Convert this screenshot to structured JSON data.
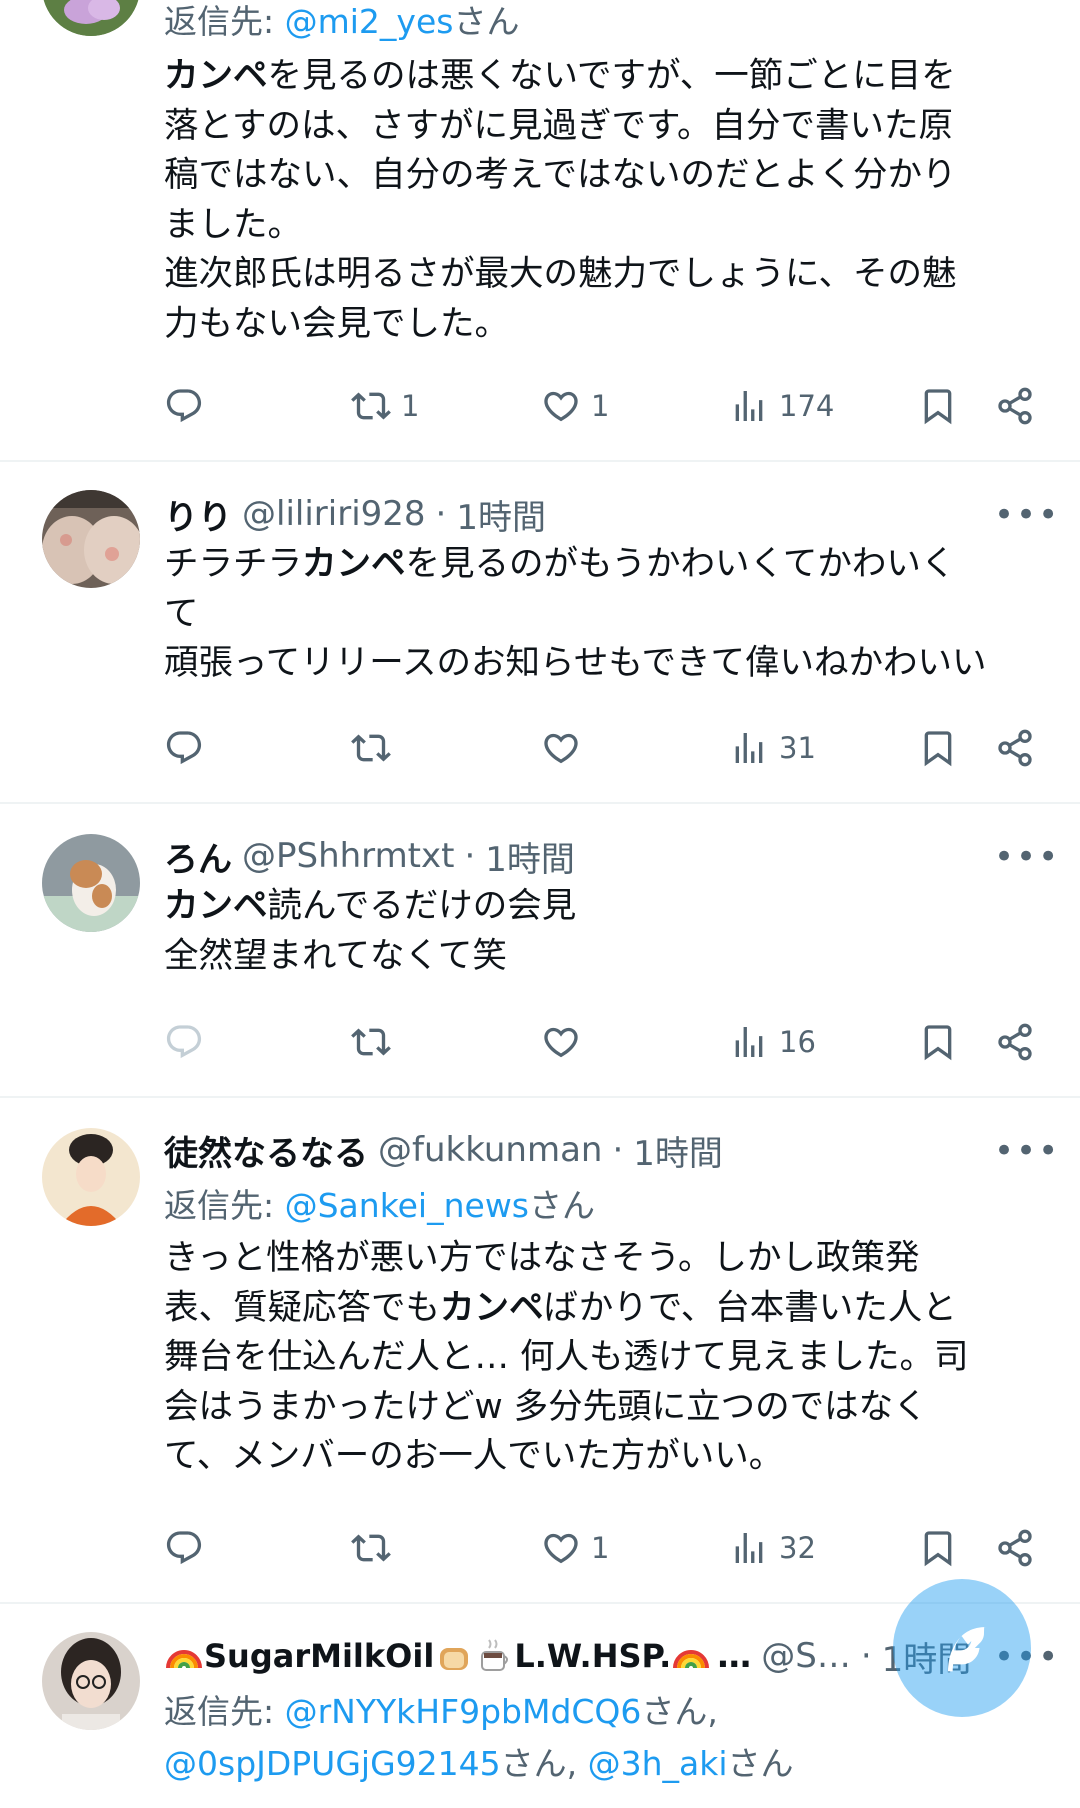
{
  "tweets": [
    {
      "reply_prefix": "返信先: ",
      "reply_link": "@mi2_yes",
      "reply_suffix": "さん",
      "body_lines": [
        [
          "カンペ",
          "を見るのは悪くないですが、一節ごとに目を"
        ],
        [
          "",
          "落とすのは、さすがに見過ぎです。自分で書いた原"
        ],
        [
          "",
          "稿ではない、自分の考えではないのだとよく分かり"
        ],
        [
          "",
          "ました。"
        ],
        [
          "",
          "進次郎氏は明るさが最大の魅力でしょうに、その魅"
        ],
        [
          "",
          "力もない会見でした。"
        ]
      ],
      "retweets": "1",
      "likes": "1",
      "views": "174"
    },
    {
      "name": "りり",
      "handle": "@liliriri928",
      "dot": "·",
      "time": "1時間",
      "more": "•••",
      "body_line1_a": "チラチラ",
      "body_line1_b": "カンペ",
      "body_line1_c": "を見るのがもうかわいくてかわいく",
      "body_line2": "て",
      "body_line3": "頑張ってリリースのお知らせもできて偉いねかわいい",
      "views": "31"
    },
    {
      "name": "ろん",
      "handle": "@PShhrmtxt",
      "dot": "·",
      "time": "1時間",
      "more": "•••",
      "body_line1_a": "カンペ",
      "body_line1_b": "読んでるだけの会見",
      "body_line2": "全然望まれてなくて笑",
      "views": "16"
    },
    {
      "name": "徒然なるなる",
      "handle": "@fukkunman",
      "dot": "·",
      "time": "1時間",
      "more": "•••",
      "reply_prefix": "返信先: ",
      "reply_link": "@Sankei_news",
      "reply_suffix": "さん",
      "body_line1": "きっと性格が悪い方ではなさそう。しかし政策発",
      "body_line2_a": "表、質疑応答でも",
      "body_line2_b": "カンペ",
      "body_line2_c": "ばかりで、台本書いた人と",
      "body_line3": "舞台を仕込んだ人と… 何人も透けて見えました。司",
      "body_line4": "会はうまかったけどw 多分先頭に立つのではなく",
      "body_line5": "て、メンバーのお一人でいた方がいい。",
      "likes": "1",
      "views": "32"
    },
    {
      "name_a": "SugarMilkOil",
      "name_b": "L.W.HSP.",
      "name_c": "…",
      "handle": "@S…",
      "dot": "·",
      "time": "1時間",
      "more": "•••",
      "reply_prefix": "返信先: ",
      "reply_link1": "@rNYYkHF9pbMdCQ6",
      "reply_suffix1": "さん,",
      "reply_link2": "@0spJDPUGjG92145",
      "reply_suffix2": "さん, ",
      "reply_link3": "@3h_aki",
      "reply_suffix3": "さん"
    }
  ],
  "icons": {
    "reply": "reply-icon",
    "retweet": "retweet-icon",
    "like": "heart-icon",
    "views": "views-icon",
    "bookmark": "bookmark-icon",
    "share": "share-icon",
    "compose": "compose-icon"
  },
  "colors": {
    "link": "#1d9bf0",
    "secondary_text": "#536471",
    "fab": "#8ecdf7"
  }
}
